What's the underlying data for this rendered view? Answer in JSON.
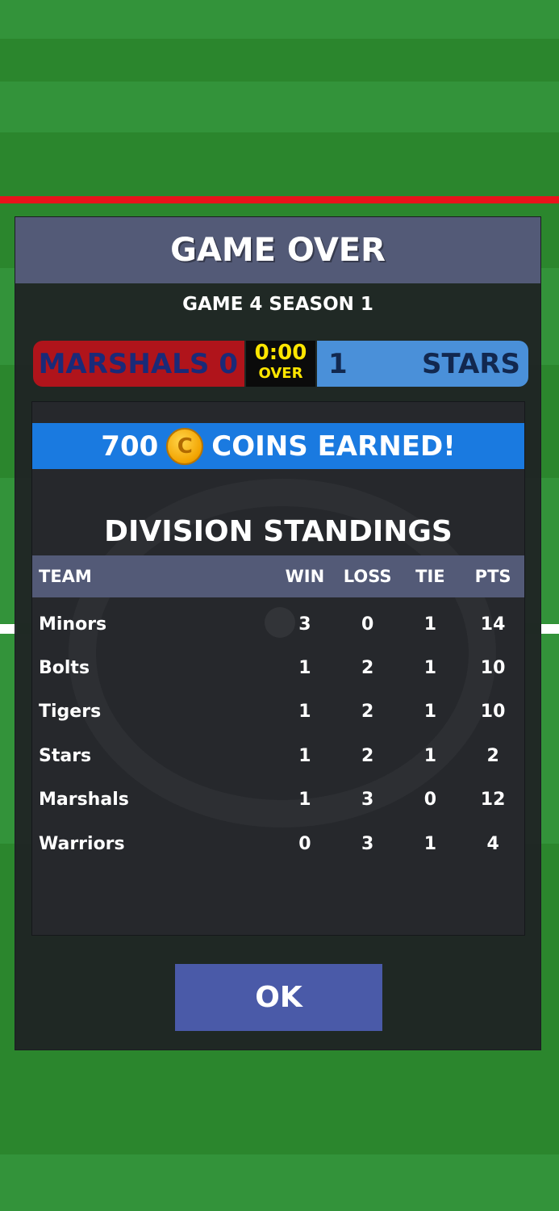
{
  "colors": {
    "field_green": "#2f8f31",
    "header_slate": "#535a77",
    "home_red": "#b0141b",
    "away_blue": "#4a90d9",
    "clock_yellow": "#ffe600",
    "coins_blue": "#1a7ae0",
    "ok_blue": "#4a5aa8"
  },
  "dialog": {
    "title": "GAME OVER",
    "subtitle": "GAME 4 SEASON 1"
  },
  "scoreboard": {
    "home_team": "MARSHALS",
    "home_score": "0",
    "clock_time": "0:00",
    "clock_status": "OVER",
    "away_score": "1",
    "away_team": "STARS"
  },
  "coins": {
    "amount": "700",
    "icon": "coin-icon",
    "icon_glyph": "C",
    "label": "COINS EARNED!"
  },
  "standings": {
    "title": "DIVISION STANDINGS",
    "headers": [
      "TEAM",
      "WIN",
      "LOSS",
      "TIE",
      "PTS"
    ],
    "rows": [
      [
        "Minors",
        "3",
        "0",
        "1",
        "14"
      ],
      [
        "Bolts",
        "1",
        "2",
        "1",
        "10"
      ],
      [
        "Tigers",
        "1",
        "2",
        "1",
        "10"
      ],
      [
        "Stars",
        "1",
        "2",
        "1",
        "2"
      ],
      [
        "Marshals",
        "1",
        "3",
        "0",
        "12"
      ],
      [
        "Warriors",
        "0",
        "3",
        "1",
        "4"
      ]
    ]
  },
  "ok_button": {
    "label": "OK"
  }
}
